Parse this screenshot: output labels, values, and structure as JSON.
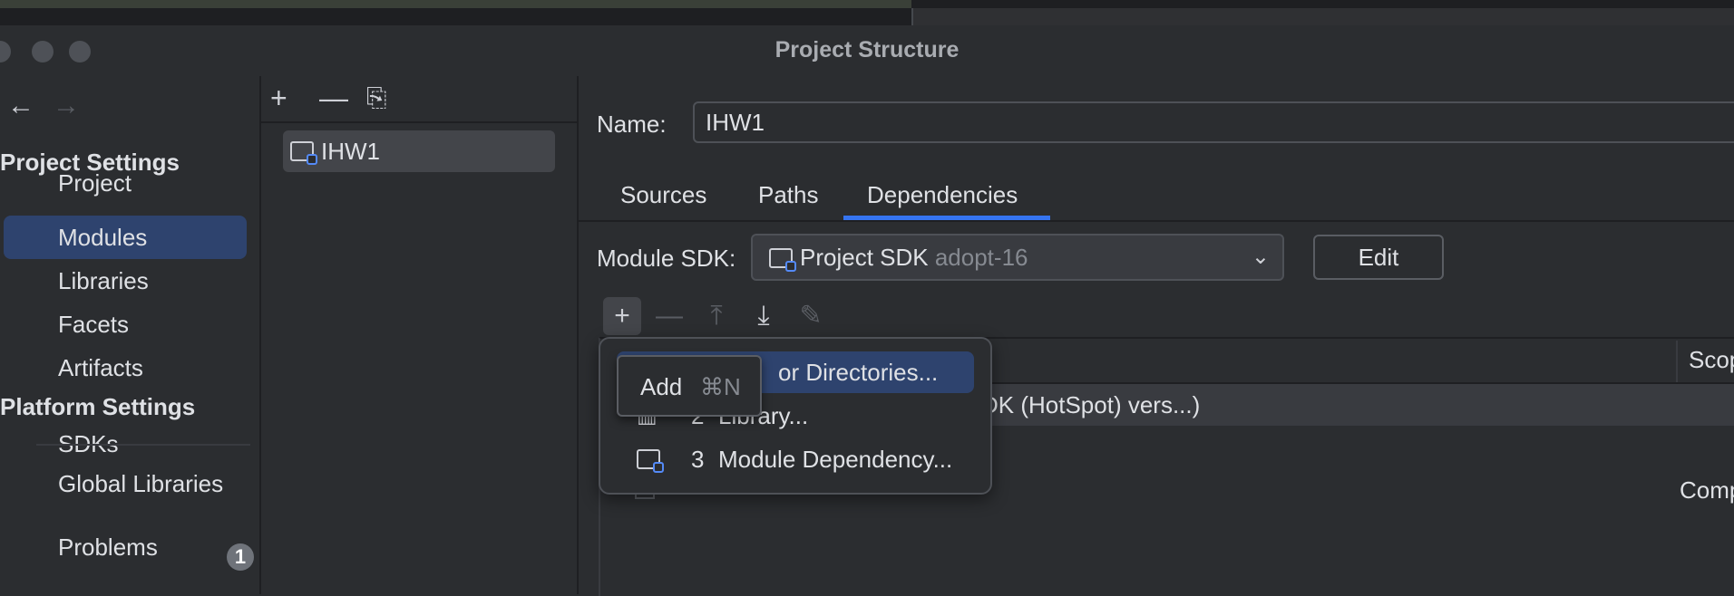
{
  "window": {
    "title": "Project Structure"
  },
  "nav": {
    "back": "←",
    "forward": "→"
  },
  "sidebar": {
    "project_settings_header": "Project Settings",
    "project_items": [
      {
        "label": "Project"
      },
      {
        "label": "Modules"
      },
      {
        "label": "Libraries"
      },
      {
        "label": "Facets"
      },
      {
        "label": "Artifacts"
      }
    ],
    "platform_settings_header": "Platform Settings",
    "platform_items": [
      {
        "label": "SDKs"
      },
      {
        "label": "Global Libraries"
      }
    ],
    "problems": {
      "label": "Problems",
      "count": "1"
    }
  },
  "modules_pane": {
    "toolbar": {
      "add": "+",
      "remove": "—",
      "copy": "⎘"
    },
    "modules": [
      {
        "name": "IHW1"
      }
    ]
  },
  "module": {
    "name_label": "Name:",
    "name_value": "IHW1",
    "tabs": [
      {
        "label": "Sources"
      },
      {
        "label": "Paths"
      },
      {
        "label": "Dependencies"
      }
    ],
    "active_tab": "Dependencies",
    "sdk": {
      "label": "Module SDK:",
      "value": "Project SDK",
      "value_detail": "adopt-16",
      "edit_label": "Edit"
    }
  },
  "dependencies": {
    "toolbar": {
      "add": "+",
      "remove": "—",
      "move_up": "⤒",
      "move_down": "⤓",
      "edit": "✎"
    },
    "scope_header": "Scop",
    "rows": [
      {
        "text": "DK (HotSpot) vers...)"
      },
      {
        "scope": "Comp"
      }
    ]
  },
  "add_popup": {
    "items": [
      {
        "number": "",
        "label": "or Directories..."
      },
      {
        "number": "2",
        "label": "Library..."
      },
      {
        "number": "3",
        "label": "Module Dependency..."
      }
    ]
  },
  "tooltip": {
    "label": "Add",
    "shortcut": "⌘N"
  },
  "colors": {
    "accent": "#3574f0",
    "selection": "#2e436e",
    "background": "#2b2d30"
  }
}
